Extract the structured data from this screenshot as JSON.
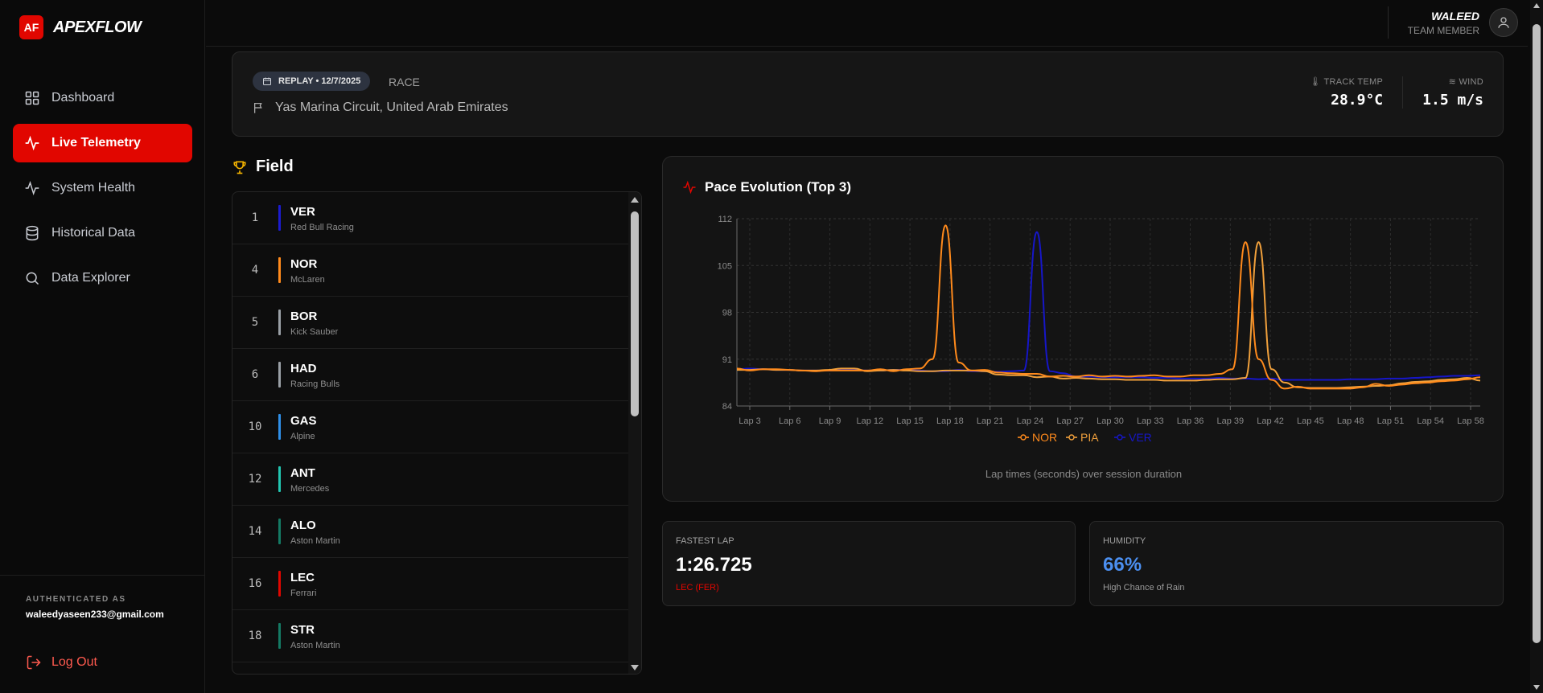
{
  "brand": {
    "mark": "AF",
    "name": "APEXFLOW"
  },
  "nav": [
    {
      "label": "Dashboard",
      "icon": "grid-icon"
    },
    {
      "label": "Live Telemetry",
      "icon": "activity-icon",
      "active": true
    },
    {
      "label": "System Health",
      "icon": "pulse-icon"
    },
    {
      "label": "Historical Data",
      "icon": "database-icon"
    },
    {
      "label": "Data Explorer",
      "icon": "search-icon"
    }
  ],
  "auth": {
    "label": "AUTHENTICATED AS",
    "email": "waleedyaseen233@gmail.com",
    "logout": "Log Out"
  },
  "user": {
    "name": "WALEED",
    "role": "TEAM MEMBER"
  },
  "session": {
    "badge": "REPLAY • 12/7/2025",
    "type": "RACE",
    "circuit": "Yas Marina Circuit, United Arab Emirates",
    "track_temp_label": "TRACK TEMP",
    "track_temp": "28.9°C",
    "wind_label": "WIND",
    "wind": "1.5 m/s"
  },
  "field": {
    "title": "Field",
    "drivers": [
      {
        "pos": "1",
        "code": "VER",
        "team": "Red Bull Racing",
        "color": "#1b1bcf"
      },
      {
        "pos": "4",
        "code": "NOR",
        "team": "McLaren",
        "color": "#ff8a1c"
      },
      {
        "pos": "5",
        "code": "BOR",
        "team": "Kick Sauber",
        "color": "#9aa0a6"
      },
      {
        "pos": "6",
        "code": "HAD",
        "team": "Racing Bulls",
        "color": "#9aa0a6"
      },
      {
        "pos": "10",
        "code": "GAS",
        "team": "Alpine",
        "color": "#2f8fe8"
      },
      {
        "pos": "12",
        "code": "ANT",
        "team": "Mercedes",
        "color": "#22c5b0"
      },
      {
        "pos": "14",
        "code": "ALO",
        "team": "Aston Martin",
        "color": "#147a64"
      },
      {
        "pos": "16",
        "code": "LEC",
        "team": "Ferrari",
        "color": "#e10600"
      },
      {
        "pos": "18",
        "code": "STR",
        "team": "Aston Martin",
        "color": "#147a64"
      }
    ]
  },
  "pace_chart": {
    "title": "Pace Evolution (Top 3)",
    "caption": "Lap times (seconds) over session duration"
  },
  "chart_data": {
    "type": "line",
    "x": [
      1,
      2,
      3,
      4,
      5,
      6,
      7,
      8,
      9,
      10,
      11,
      12,
      13,
      14,
      15,
      16,
      17,
      18,
      19,
      20,
      21,
      22,
      23,
      24,
      25,
      26,
      27,
      28,
      29,
      30,
      31,
      32,
      33,
      34,
      35,
      36,
      37,
      38,
      39,
      40,
      41,
      42,
      43,
      44,
      45,
      46,
      47,
      48,
      49,
      50,
      51,
      52,
      53,
      54,
      55,
      56,
      57,
      58
    ],
    "x_tick_labels": [
      "Lap 3",
      "Lap 6",
      "Lap 9",
      "Lap 12",
      "Lap 15",
      "Lap 18",
      "Lap 21",
      "Lap 24",
      "Lap 27",
      "Lap 30",
      "Lap 33",
      "Lap 36",
      "Lap 39",
      "Lap 42",
      "Lap 45",
      "Lap 48",
      "Lap 51",
      "Lap 54",
      "Lap 58"
    ],
    "y_ticks": [
      84,
      91,
      98,
      105,
      112
    ],
    "ylim": [
      84,
      112
    ],
    "series": [
      {
        "name": "NOR",
        "color": "#ff8a1c",
        "values": [
          89.6,
          89.3,
          89.5,
          89.5,
          89.4,
          89.3,
          89.2,
          89.3,
          89.3,
          89.3,
          89.3,
          89.5,
          89.2,
          89.5,
          89.6,
          91.0,
          111.0,
          90.5,
          89.3,
          89.4,
          89.0,
          88.9,
          88.8,
          88.8,
          88.4,
          88.5,
          88.4,
          88.6,
          88.4,
          88.5,
          88.4,
          88.5,
          88.6,
          88.4,
          88.4,
          88.6,
          88.6,
          88.8,
          89.5,
          108.5,
          91.0,
          87.9,
          86.6,
          86.9,
          86.6,
          86.6,
          86.6,
          86.6,
          86.8,
          87.3,
          87.0,
          87.2,
          87.4,
          87.5,
          87.7,
          87.8,
          88.0,
          88.3
        ]
      },
      {
        "name": "PIA",
        "color": "#f0a03c",
        "values": [
          89.4,
          89.4,
          89.5,
          89.4,
          89.4,
          89.3,
          89.3,
          89.4,
          89.6,
          89.6,
          89.2,
          89.3,
          89.4,
          89.3,
          89.2,
          89.2,
          89.3,
          89.3,
          89.3,
          89.2,
          88.7,
          88.6,
          88.6,
          88.3,
          88.4,
          88.1,
          88.2,
          88.1,
          88.0,
          88.0,
          87.9,
          87.9,
          87.9,
          87.8,
          87.8,
          87.8,
          87.9,
          88.0,
          88.0,
          88.2,
          108.5,
          89.5,
          87.5,
          86.8,
          86.7,
          86.7,
          86.7,
          86.8,
          86.9,
          87.0,
          87.1,
          87.4,
          87.6,
          87.7,
          87.9,
          88.0,
          88.2,
          87.8
        ]
      },
      {
        "name": "VER",
        "color": "#1616c8",
        "values": [
          89.5,
          89.6,
          89.5,
          89.4,
          89.4,
          89.3,
          89.3,
          89.3,
          89.4,
          89.4,
          89.3,
          89.3,
          89.4,
          89.4,
          89.3,
          89.2,
          89.2,
          89.4,
          89.2,
          89.2,
          89.1,
          89.2,
          89.3,
          110.0,
          89.2,
          88.9,
          88.4,
          88.4,
          88.3,
          88.3,
          88.3,
          88.3,
          88.2,
          88.2,
          88.1,
          88.1,
          88.1,
          88.2,
          88.1,
          88.1,
          88.0,
          88.1,
          87.9,
          87.9,
          87.9,
          87.9,
          87.9,
          88.0,
          88.0,
          88.0,
          88.1,
          88.1,
          88.2,
          88.3,
          88.4,
          88.5,
          88.5,
          88.6
        ]
      }
    ]
  },
  "fastest_lap": {
    "label": "FASTEST LAP",
    "value": "1:26.725",
    "driver": "LEC (FER)",
    "color": "#e10600"
  },
  "humidity": {
    "label": "HUMIDITY",
    "value": "66%",
    "note": "High Chance of Rain",
    "color": "#4b8ff0"
  }
}
